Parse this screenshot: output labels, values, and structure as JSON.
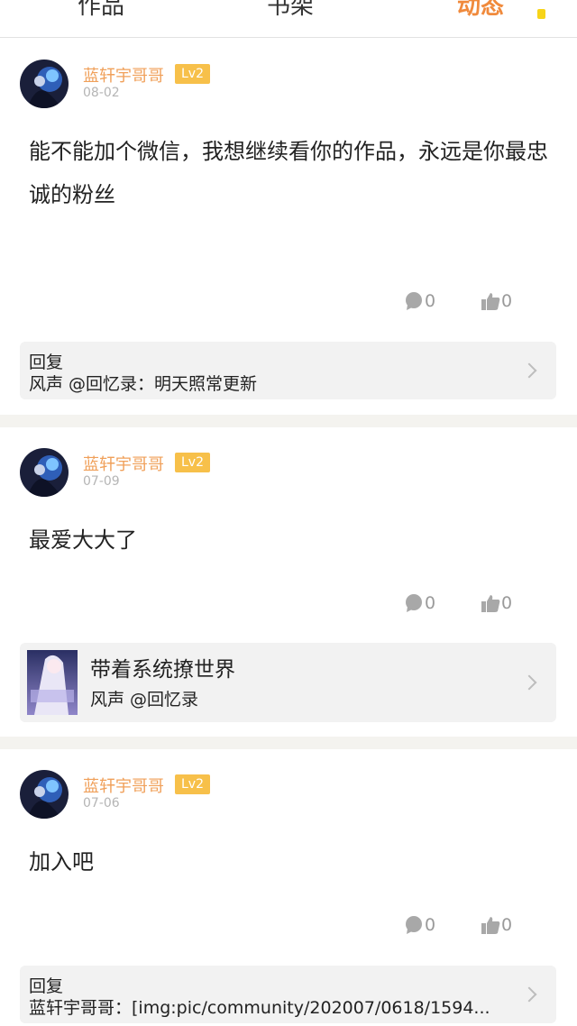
{
  "tabs": [
    {
      "label": "作品"
    },
    {
      "label": "书架"
    },
    {
      "label": "动态"
    }
  ],
  "accent_color": "#f08a3c",
  "posts": [
    {
      "username": "蓝轩宇哥哥",
      "level": "Lv2",
      "date": "08-02",
      "content": "能不能加个微信，我想继续看你的作品，永远是你最忠诚的粉丝",
      "comment_count": "0",
      "like_count": "0",
      "attachment": {
        "type": "reply",
        "title": "回复",
        "text": "风声 @回忆录：明天照常更新"
      }
    },
    {
      "username": "蓝轩宇哥哥",
      "level": "Lv2",
      "date": "07-09",
      "content": "最爱大大了",
      "comment_count": "0",
      "like_count": "0",
      "attachment": {
        "type": "book",
        "title": "带着系统撩世界",
        "author": "风声 @回忆录"
      }
    },
    {
      "username": "蓝轩宇哥哥",
      "level": "Lv2",
      "date": "07-06",
      "content": "加入吧",
      "comment_count": "0",
      "like_count": "0",
      "attachment": {
        "type": "reply",
        "title": "回复",
        "text": "蓝轩宇哥哥：[img:pic/community/202007/0618/1594..."
      }
    }
  ]
}
